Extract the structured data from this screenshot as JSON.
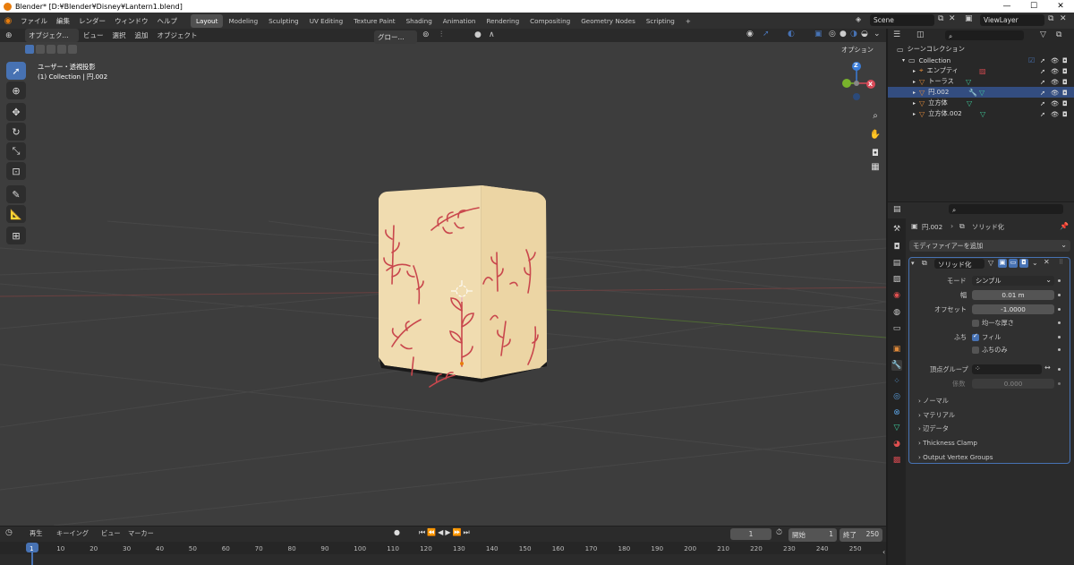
{
  "window": {
    "title": "Blender* [D:¥Blender¥Disney¥Lantern1.blend]",
    "minimize": "—",
    "maximize": "☐",
    "close": "✕"
  },
  "menu": [
    "ファイル",
    "編集",
    "レンダー",
    "ウィンドウ",
    "ヘルプ"
  ],
  "workspaces": [
    "Layout",
    "Modeling",
    "Sculpting",
    "UV Editing",
    "Texture Paint",
    "Shading",
    "Animation",
    "Rendering",
    "Compositing",
    "Geometry Nodes",
    "Scripting"
  ],
  "active_workspace": "Layout",
  "add_workspace": "+",
  "scene": {
    "name": "Scene",
    "view_layer": "ViewLayer"
  },
  "viewport": {
    "mode": "オブジェク...",
    "menus": [
      "ビュー",
      "選択",
      "追加",
      "オブジェクト"
    ],
    "orientation": "グロー...",
    "options_label": "オプション",
    "view_title": "ユーザー・透視投影",
    "view_info": "(1) Collection | 円.002",
    "gizmo": {
      "z": "Z",
      "x": "X",
      "y": "Y"
    }
  },
  "outliner": {
    "root": "シーンコレクション",
    "collection": "Collection",
    "items": [
      {
        "name": "エンプティ",
        "icon": "empty-icon",
        "color": "#e08a3a"
      },
      {
        "name": "トーラス",
        "icon": "mesh-icon",
        "color": "#e08a3a"
      },
      {
        "name": "円.002",
        "icon": "mesh-icon",
        "color": "#e08a3a"
      },
      {
        "name": "立方体",
        "icon": "mesh-icon",
        "color": "#e08a3a"
      },
      {
        "name": "立方体.002",
        "icon": "mesh-icon",
        "color": "#e08a3a"
      }
    ]
  },
  "properties": {
    "breadcrumb_object": "円.002",
    "breadcrumb_modifier": "ソリッド化",
    "add_modifier": "モディファイアーを追加",
    "modifier_name": "ソリッド化",
    "mode_label": "モード",
    "mode_value": "シンプル",
    "width_label": "幅",
    "width_value": "0.01 m",
    "offset_label": "オフセット",
    "offset_value": "-1.0000",
    "even_thickness": "均一な厚さ",
    "rim_label": "ふち",
    "fill": "フィル",
    "fill_checked": true,
    "rim_only": "ふちのみ",
    "vertex_group_label": "頂点グループ",
    "factor_label": "係数",
    "factor_value": "0.000",
    "subpanels": [
      "ノーマル",
      "マテリアル",
      "辺データ",
      "Thickness Clamp",
      "Output Vertex Groups"
    ]
  },
  "timeline": {
    "menus": [
      "再生",
      "キーイング",
      "ビュー",
      "マーカー"
    ],
    "current_frame": "1",
    "start_label": "開始",
    "start": "1",
    "end_label": "終了",
    "end": "250",
    "ruler": [
      "1",
      "10",
      "20",
      "30",
      "40",
      "50",
      "60",
      "70",
      "80",
      "90",
      "100",
      "110",
      "120",
      "130",
      "140",
      "150",
      "160",
      "170",
      "180",
      "190",
      "200",
      "210",
      "220",
      "230",
      "240",
      "250"
    ]
  },
  "colors": {
    "accent": "#4772b3",
    "lantern": "#f0dcb0",
    "leaf": "#c9474d"
  }
}
